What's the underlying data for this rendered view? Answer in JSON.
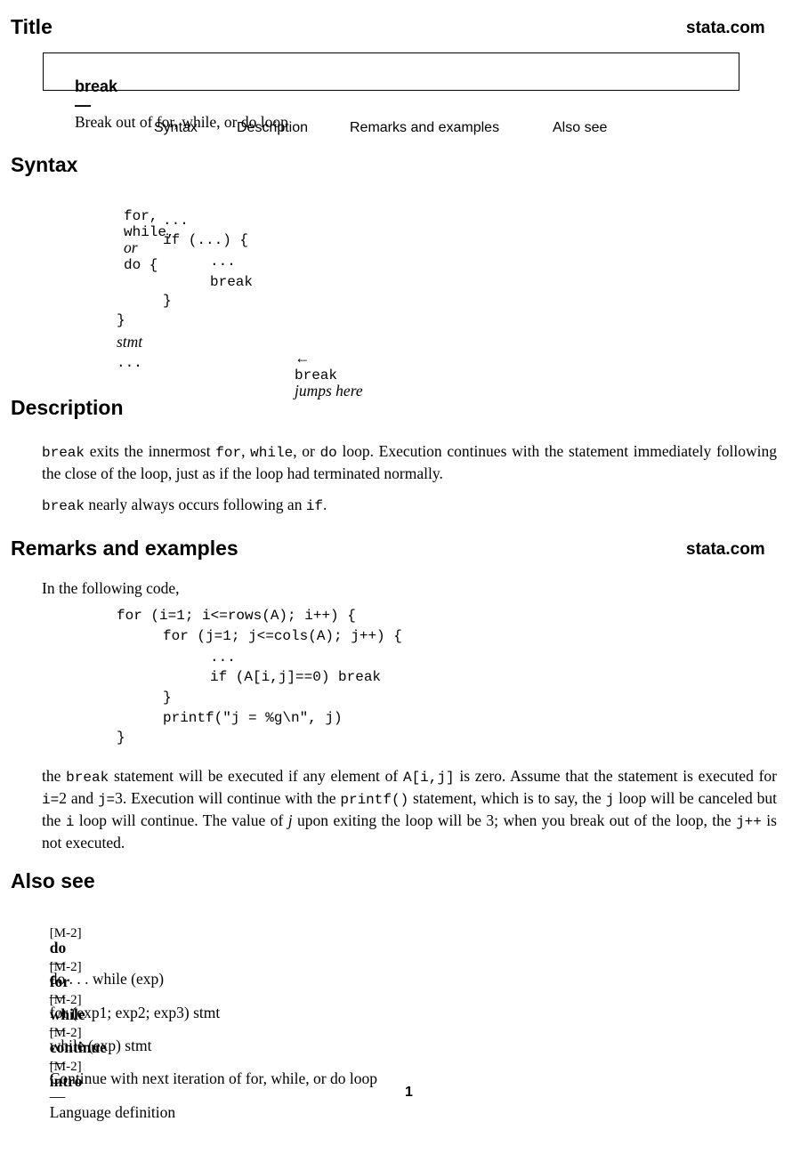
{
  "header": {
    "title": "Title",
    "site": "stata.com"
  },
  "title_box": {
    "command": "break",
    "dash": "—",
    "description": "Break out of for, while, or do loop"
  },
  "nav": {
    "links": [
      "Syntax",
      "Description",
      "Remarks and examples",
      "Also see"
    ]
  },
  "syntax": {
    "heading": "Syntax",
    "code": {
      "line1_for": "for,",
      "line1_while": "while,",
      "line1_or": "or",
      "line1_do": "do {",
      "line2": "...",
      "line3": "if (...) {",
      "line4": "...",
      "line5": "break",
      "line6": "}",
      "line7": "}",
      "stmt": "stmt",
      "arrow": "←",
      "arrow_break": "break",
      "arrow_text": "jumps here",
      "last": "..."
    }
  },
  "description": {
    "heading": "Description",
    "p1": {
      "t1": "break",
      "t2": " exits the innermost ",
      "t3": "for",
      "t4": ", ",
      "t5": "while",
      "t6": ", or ",
      "t7": "do",
      "t8": " loop. Execution continues with the statement immediately following the close of the loop, just as if the loop had terminated normally."
    },
    "p2": {
      "t1": "break",
      "t2": " nearly always occurs following an ",
      "t3": "if",
      "t4": "."
    }
  },
  "remarks": {
    "heading": "Remarks and examples",
    "site": "stata.com",
    "intro": "In the following code,",
    "code": [
      "for (i=1; i<=rows(A); i++) {",
      "for (j=1; j<=cols(A); j++) {",
      "...",
      "if (A[i,j]==0) break",
      "}",
      "printf(\"j = %g\\n\", j)",
      "}"
    ],
    "para": {
      "t1": "the ",
      "t2": "break",
      "t3": " statement will be executed if any element of ",
      "t4": "A[i,j]",
      "t5": " is zero. Assume that the statement is executed for ",
      "t6": "i=",
      "t7": "2 and ",
      "t8": "j=",
      "t9": "3. Execution will continue with the ",
      "t10": "printf()",
      "t11": " statement, which is to say, the ",
      "t12": "j",
      "t13": " loop will be canceled but the ",
      "t14": "i",
      "t15": " loop will continue. The value of ",
      "t16": "j",
      "t17": " upon exiting the loop will be 3; when you break out of the loop, the ",
      "t18": "j++",
      "t19": " is not executed."
    }
  },
  "also_see": {
    "heading": "Also see",
    "items": [
      {
        "tag": "[M-2]",
        "name": "do",
        "dash": "—",
        "desc": "do . . . while (exp)"
      },
      {
        "tag": "[M-2]",
        "name": "for",
        "dash": "—",
        "desc": "for (exp1; exp2; exp3) stmt"
      },
      {
        "tag": "[M-2]",
        "name": "while",
        "dash": "—",
        "desc": "while (exp) stmt"
      },
      {
        "tag": "[M-2]",
        "name": "continue",
        "dash": "—",
        "desc": "Continue with next iteration of for, while, or do loop"
      },
      {
        "tag": "[M-2]",
        "name": "intro",
        "dash": "—",
        "desc": "Language definition"
      }
    ]
  },
  "footer": {
    "page_number": "1"
  }
}
